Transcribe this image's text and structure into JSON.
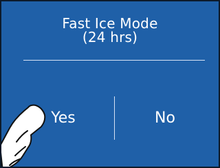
{
  "dialog": {
    "title_line1": "Fast Ice Mode",
    "title_line2": "(24 hrs)",
    "yes_label": "Yes",
    "no_label": "No"
  },
  "colors": {
    "panel_bg": "#1f60a8",
    "text": "#ffffff",
    "divider": "#d7e3f5"
  },
  "icons": {
    "pointer": "pointing-hand-icon"
  }
}
